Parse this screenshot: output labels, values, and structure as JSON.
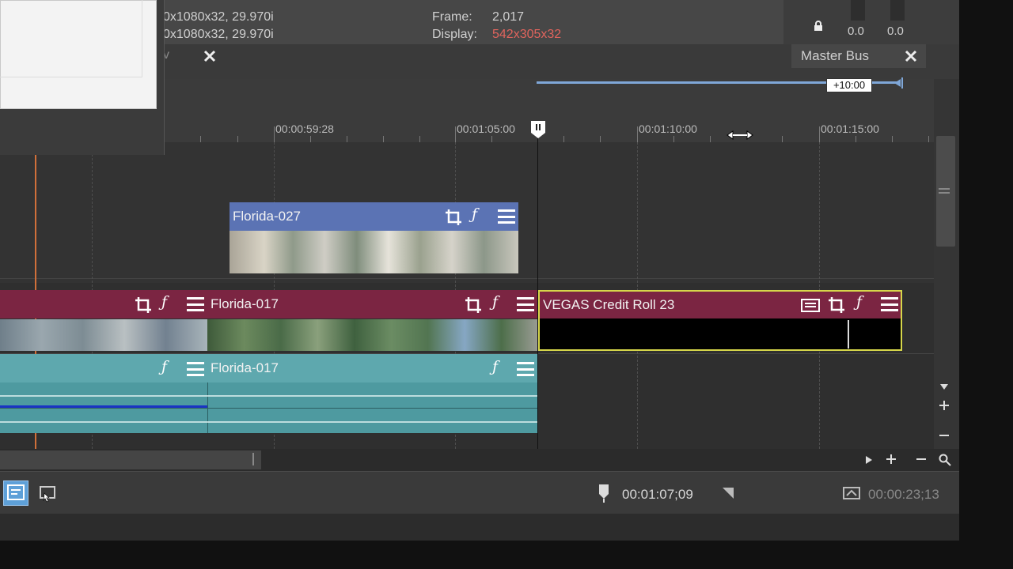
{
  "top_info": {
    "line1": "0x1080x32, 29.970i",
    "line2": "0x1080x32, 29.970i",
    "frame_label": "Frame:",
    "frame_value": "2,017",
    "display_label": "Display:",
    "display_value": "542x305x32",
    "tab_fragment": "v"
  },
  "master": {
    "level_left": "0.0",
    "level_right": "0.0",
    "title": "Master Bus"
  },
  "loop_region_label": "+10:00",
  "ruler": {
    "labels": [
      "00:00:59:28",
      "00:01:05:00",
      "00:01:10:00",
      "00:01:15:00"
    ]
  },
  "clips": {
    "florida027": "Florida-027",
    "video017": "Florida-017",
    "credit": "VEGAS Credit Roll 23",
    "audio017": "Florida-017"
  },
  "status": {
    "cursor_time": "00:01:07;09",
    "selection_length": "00:00:23;13"
  },
  "colors": {
    "video_track": "#7b2542",
    "audio_track": "#5ea8ae",
    "clip_blue": "#5b73b4",
    "playhead": "#ffffff",
    "cursor_line": "#d0703a",
    "selection_outline": "#d6d64a"
  }
}
